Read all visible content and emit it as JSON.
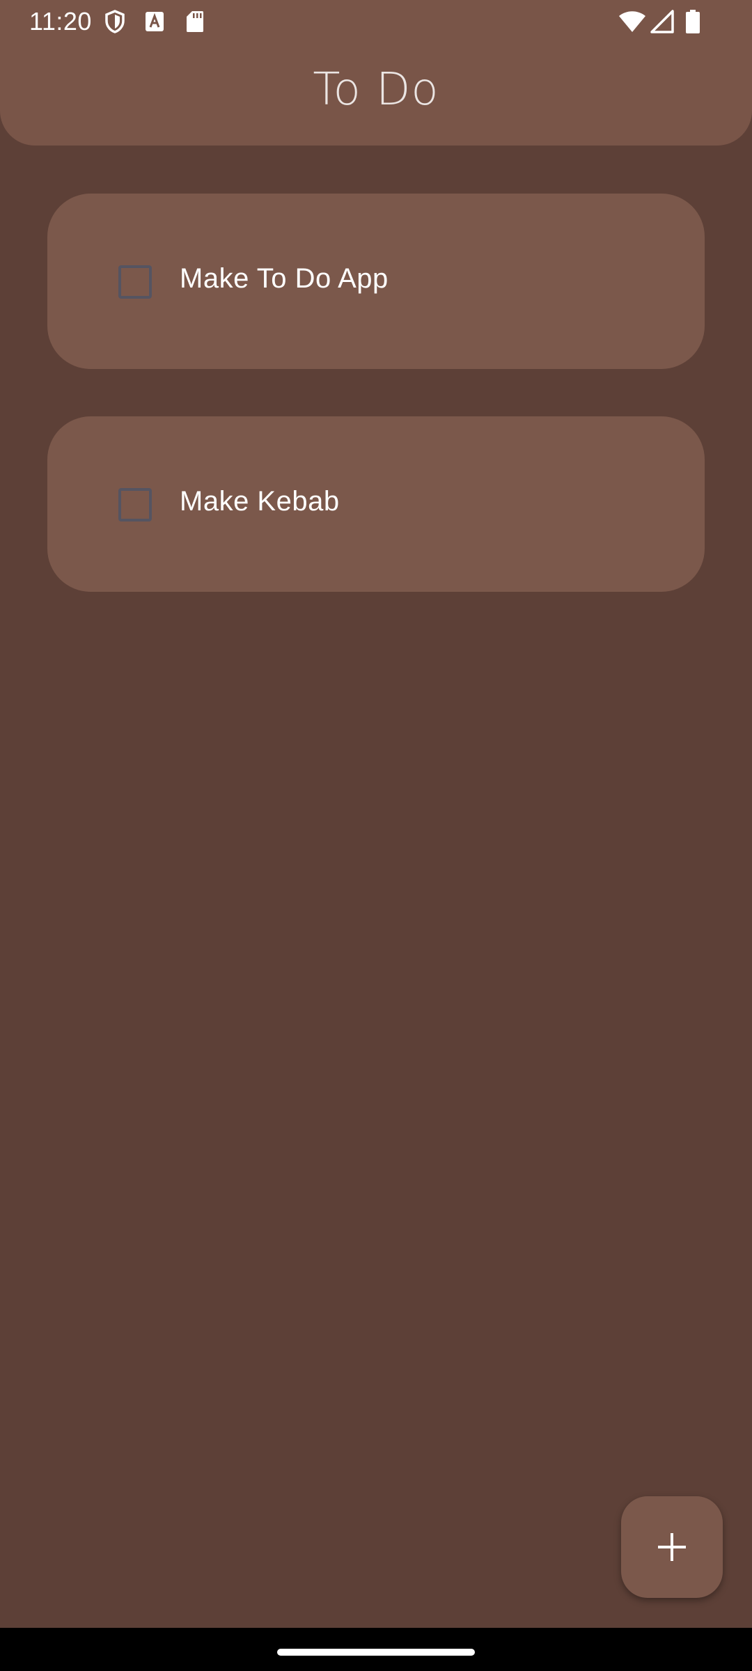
{
  "status_bar": {
    "time": "11:20",
    "icons": [
      "shield-icon",
      "keyboard-a-icon",
      "sd-card-icon",
      "wifi-icon",
      "signal-icon",
      "battery-icon"
    ]
  },
  "app_bar": {
    "title": "To Do"
  },
  "tasks": [
    {
      "label": "Make To Do App",
      "checked": false
    },
    {
      "label": "Make Kebab",
      "checked": false
    }
  ],
  "fab": {
    "icon": "plus-icon"
  },
  "colors": {
    "background": "#5d4037",
    "app_bar": "#795548",
    "card": "#7b584b",
    "checkbox_border": "#555461",
    "text": "#ffffff"
  }
}
